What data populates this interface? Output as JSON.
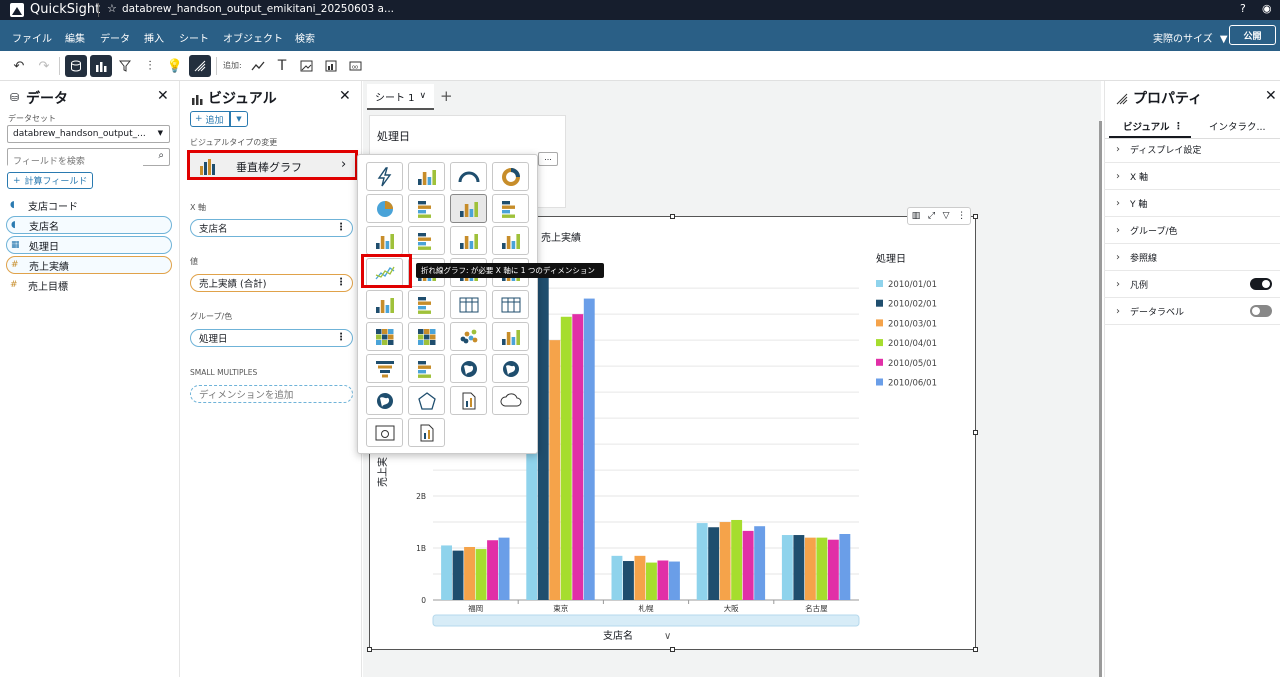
{
  "app": {
    "name": "QuickSight",
    "doc_title": "databrew_handson_output_emikitani_20250603 a..."
  },
  "menu": {
    "items": [
      "ファイル",
      "編集",
      "データ",
      "挿入",
      "シート",
      "オブジェクト",
      "検索"
    ],
    "size_label": "実際のサイズ",
    "publish_label": "公開"
  },
  "toolbar": {
    "add_label": "追加:"
  },
  "data_panel": {
    "title": "データ",
    "dataset_label": "データセット",
    "dataset_value": "databrew_handson_output_...",
    "search_placeholder": "フィールドを検索",
    "calc_field_label": "計算フィールド",
    "fields": [
      {
        "name": "支店コード",
        "kind": "dimension",
        "selected": false
      },
      {
        "name": "支店名",
        "kind": "dimension",
        "selected": true
      },
      {
        "name": "処理日",
        "kind": "date",
        "selected": true
      },
      {
        "name": "売上実績",
        "kind": "measure",
        "selected": true
      },
      {
        "name": "売上目標",
        "kind": "measure",
        "selected": false
      }
    ]
  },
  "visual_panel": {
    "title": "ビジュアル",
    "add_label": "追加",
    "type_change_label": "ビジュアルタイプの変更",
    "current_type": "垂直棒グラフ",
    "x_axis_label": "X 軸",
    "x_axis_field": "支店名",
    "value_label": "値",
    "value_field": "売上実績 (合計)",
    "group_label": "グループ/色",
    "group_field": "処理日",
    "small_multiples_label": "SMALL MULTIPLES",
    "small_multiples_placeholder": "ディメンションを追加"
  },
  "sheet": {
    "tab_label": "シート 1"
  },
  "filter_card": {
    "title": "処理日"
  },
  "tooltip": {
    "text": "折れ線グラフ: が必要 X 軸に 1 つのディメンション"
  },
  "properties": {
    "title": "プロパティ",
    "tabs": [
      "ビジュアル",
      "インタラク..."
    ],
    "rows": [
      {
        "label": "ディスプレイ設定",
        "toggle": null
      },
      {
        "label": "X 軸",
        "toggle": null
      },
      {
        "label": "Y 軸",
        "toggle": null
      },
      {
        "label": "グループ/色",
        "toggle": null
      },
      {
        "label": "参照線",
        "toggle": null
      },
      {
        "label": "凡例",
        "toggle": "on"
      },
      {
        "label": "データラベル",
        "toggle": "off"
      }
    ]
  },
  "colors": {
    "series": [
      "#8fd3ec",
      "#1f4e6e",
      "#f5a34a",
      "#a6dd2e",
      "#e12fa7",
      "#6a9ee8"
    ],
    "accent": "#2a5f86"
  },
  "chart_data": {
    "type": "bar",
    "title": "売上実績",
    "ylabel": "売上実",
    "xlabel": "支店名",
    "legend_title": "処理日",
    "legend_position": "right",
    "categories": [
      "福岡",
      "東京",
      "札幌",
      "大阪",
      "名古屋"
    ],
    "y_ticks": [
      {
        "value": 0,
        "label": "0"
      },
      {
        "value": 1,
        "label": "1B"
      },
      {
        "value": 2,
        "label": "2B"
      }
    ],
    "ylim": [
      0,
      6.6
    ],
    "grid": true,
    "series": [
      {
        "name": "2010/01/01",
        "values": [
          1.05,
          6.0,
          0.85,
          1.48,
          1.25
        ]
      },
      {
        "name": "2010/02/01",
        "values": [
          0.95,
          6.2,
          0.75,
          1.4,
          1.25
        ]
      },
      {
        "name": "2010/03/01",
        "values": [
          1.02,
          5.0,
          0.85,
          1.5,
          1.2
        ]
      },
      {
        "name": "2010/04/01",
        "values": [
          0.98,
          5.45,
          0.72,
          1.54,
          1.2
        ]
      },
      {
        "name": "2010/05/01",
        "values": [
          1.15,
          5.5,
          0.76,
          1.33,
          1.16
        ]
      },
      {
        "name": "2010/06/01",
        "values": [
          1.2,
          5.8,
          0.74,
          1.42,
          1.27
        ]
      }
    ]
  }
}
